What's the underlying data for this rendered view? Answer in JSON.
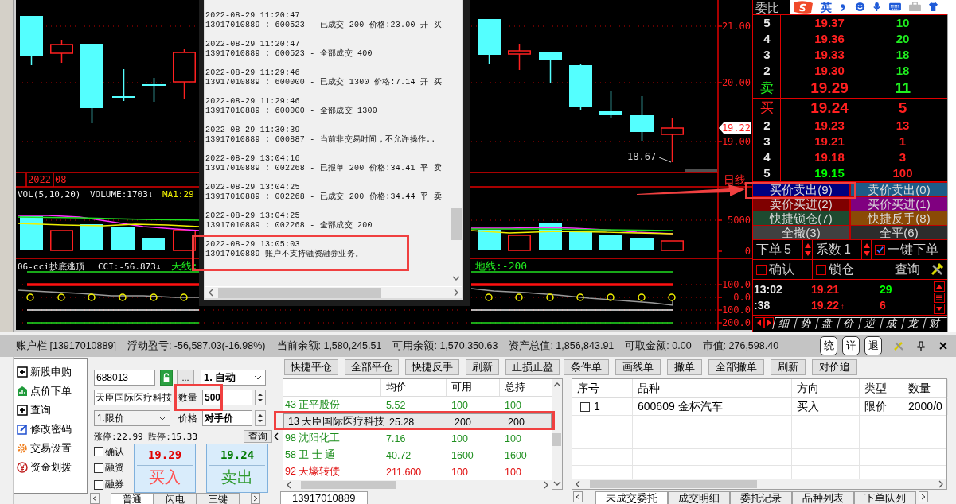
{
  "chart": {
    "price_axis": [
      "21.00",
      "20.00",
      "19.00"
    ],
    "last_price_tag": "19.22",
    "low_label": "18.67",
    "date_labels": [
      "2022",
      "08"
    ],
    "period": "日线",
    "volume_panel": {
      "indicator": "VOL(5,10,20)",
      "reading": "VOLUME:1703↓",
      "ma": "MA1:29"
    },
    "volume_axis": [
      "5000",
      "0"
    ],
    "cci_panel": {
      "indicator": "06-cci抄底逃顶",
      "reading": "CCI:-56.873↓",
      "upper": "天线:",
      "lower": "地线:-200"
    },
    "cci_axis": [
      "100.0",
      "0.0",
      "100.0",
      "200.0"
    ]
  },
  "log_window": {
    "entries": [
      {
        "time": "2022-08-29 11:20:47",
        "message": "13917010889 : 600523 - 已成交 200 价格:23.00 开 买"
      },
      {
        "time": "2022-08-29 11:20:47",
        "message": "13917010889 : 600523 - 全部成交 400"
      },
      {
        "time": "2022-08-29 11:29:46",
        "message": "13917010889 : 600000 - 已成交 1300 价格:7.14 开 买"
      },
      {
        "time": "2022-08-29 11:29:46",
        "message": "13917010889 : 600000 - 全部成交 1300"
      },
      {
        "time": "2022-08-29 11:30:39",
        "message": "13917010889 : 600887 - 当前非交易时间，不允许操作.."
      },
      {
        "time": "2022-08-29 13:04:16",
        "message": "13917010889 : 002268 - 已报单 200 价格:34.41 平 卖"
      },
      {
        "time": "2022-08-29 13:04:25",
        "message": "13917010889 : 002268 - 已成交 200 价格:34.44 平 卖"
      },
      {
        "time": "2022-08-29 13:04:25",
        "message": "13917010889 : 002268 - 全部成交 200"
      },
      {
        "time": "2022-08-29 13:05:03",
        "message": "13917010889 账户不支持融资融券业务。"
      }
    ]
  },
  "ime_toolbar": {
    "mode": "英"
  },
  "order_book": {
    "title": "委比",
    "asks": [
      {
        "level": "5",
        "price": "19.37",
        "volume": "10",
        "color": "#ff2020",
        "kind": "depth"
      },
      {
        "level": "4",
        "price": "19.36",
        "volume": "20",
        "color": "#ff2020",
        "kind": "depth"
      },
      {
        "level": "3",
        "price": "19.33",
        "volume": "18",
        "color": "#ff2020",
        "kind": "depth"
      },
      {
        "level": "2",
        "price": "19.30",
        "volume": "18",
        "color": "#ff2020",
        "kind": "depth"
      },
      {
        "level": "卖",
        "price": "19.29",
        "volume": "11",
        "color": "#ff2020",
        "kind": "best"
      }
    ],
    "bids": [
      {
        "level": "买",
        "price": "19.24",
        "volume": "5",
        "color": "#ff2020",
        "kind": "best"
      },
      {
        "level": "2",
        "price": "19.23",
        "volume": "13",
        "color": "#ff2020",
        "kind": "depth"
      },
      {
        "level": "3",
        "price": "19.21",
        "volume": "1",
        "color": "#ff2020",
        "kind": "depth"
      },
      {
        "level": "4",
        "price": "19.18",
        "volume": "3",
        "color": "#ff2020",
        "kind": "depth"
      },
      {
        "level": "5",
        "price": "19.15",
        "volume": "100",
        "color": "#00ff00",
        "kind": "depth"
      }
    ],
    "actions": [
      {
        "label": "买价卖出(9)",
        "color": "#00007f"
      },
      {
        "label": "卖价卖出(0)",
        "color": "#1d5b88"
      },
      {
        "label": "卖价买进(2)",
        "color": "#7f0000"
      },
      {
        "label": "买价买进(1)",
        "color": "#800080"
      },
      {
        "label": "快捷锁仓(7)",
        "color": "#1e4a30"
      },
      {
        "label": "快捷反手(8)",
        "color": "#8a4a06"
      },
      {
        "label": "全撤(3)",
        "color": "#404040"
      },
      {
        "label": "全平(6)",
        "color": "#2c2c2c"
      }
    ],
    "order_count": {
      "label": "下单",
      "value": "5"
    },
    "multiplier": {
      "label": "系数",
      "value": "1"
    },
    "one_click": {
      "label": "一键下单",
      "checked": true
    },
    "options": [
      {
        "label": "确认",
        "checked": false
      },
      {
        "label": "锁仓",
        "checked": false
      }
    ],
    "query": "查询",
    "ticks": [
      {
        "time": "13:02",
        "price": "19.21",
        "volume": "29",
        "color": "#00ff00"
      },
      {
        "time": ":38",
        "price": "19.22",
        "arrow": "↑",
        "volume": "6",
        "color": "#ff2020"
      }
    ],
    "tabs": [
      {
        "label": "细",
        "selected": false
      },
      {
        "label": "势",
        "selected": false
      },
      {
        "label": "盘",
        "selected": false
      },
      {
        "label": "价",
        "selected": false
      },
      {
        "label": "逆",
        "selected": false
      },
      {
        "label": "成",
        "selected": false
      },
      {
        "label": "龙",
        "selected": false
      },
      {
        "label": "财",
        "selected": false
      }
    ]
  },
  "account_bar": {
    "title": "账户栏 [13917010889]",
    "stats": [
      {
        "label": "浮动盈亏:",
        "value": "-56,587.03(-16.98%)"
      },
      {
        "label": "当前余额:",
        "value": "1,580,245.51"
      },
      {
        "label": "可用余额:",
        "value": "1,570,350.63"
      },
      {
        "label": "资产总值:",
        "value": "1,856,843.91"
      },
      {
        "label": "可取金额:",
        "value": "0.00"
      },
      {
        "label": "市值:",
        "value": "276,598.40"
      }
    ],
    "buttons": [
      "统",
      "详",
      "退"
    ]
  },
  "nav": [
    {
      "label": "新股申购",
      "kind": "group",
      "expanded": false
    },
    {
      "label": "点价下单",
      "kind": "order"
    },
    {
      "label": "查询",
      "kind": "group",
      "expanded": false
    },
    {
      "label": "修改密码",
      "kind": "password"
    },
    {
      "label": "交易设置",
      "kind": "settings"
    },
    {
      "label": "资金划拨",
      "kind": "funds"
    }
  ],
  "order_form": {
    "code": "688013",
    "browse": "...",
    "mode": "1. 自动",
    "name": "天臣国际医疗科技",
    "quantity_label": "数量",
    "quantity": "500",
    "price_type": "1.限价",
    "price_label": "价格",
    "price": "对手价",
    "limits": "涨停:22.99 跌停:15.33",
    "query": "查询",
    "options": [
      {
        "label": "确认",
        "checked": false
      },
      {
        "label": "融资",
        "checked": false
      },
      {
        "label": "融券",
        "checked": false
      }
    ],
    "buy": {
      "price": "19.29",
      "label": "买入"
    },
    "sell": {
      "price": "19.24",
      "label": "卖出"
    },
    "tabs": [
      {
        "label": "普通",
        "selected": true
      },
      {
        "label": "闪电",
        "selected": false
      },
      {
        "label": "三键",
        "selected": false
      }
    ]
  },
  "positions": {
    "toolbar": [
      "快捷平仓",
      "全部平仓",
      "快捷反手",
      "刷新",
      "止损止盈"
    ],
    "columns": [
      "",
      "均价",
      "可用",
      "总持"
    ],
    "rows": [
      {
        "cells": [
          "43 正平股份",
          "5.52",
          "100",
          "100"
        ],
        "color": "#1f8f1f",
        "selected": false
      },
      {
        "cells": [
          "13 天臣国际医疗科技",
          "25.28",
          "200",
          "200"
        ],
        "color": "#000000",
        "selected": true
      },
      {
        "cells": [
          "98 沈阳化工",
          "7.16",
          "100",
          "100"
        ],
        "color": "#1f8f1f",
        "selected": false
      },
      {
        "cells": [
          "58 卫 士 通",
          "40.72",
          "1600",
          "1600"
        ],
        "color": "#1f8f1f",
        "selected": false
      },
      {
        "cells": [
          "92 天壕转债",
          "211.600",
          "100",
          "100"
        ],
        "color": "#e01010",
        "selected": false
      }
    ],
    "tabs": [
      {
        "label": "13917010889",
        "selected": true
      }
    ]
  },
  "orders": {
    "toolbar": [
      "条件单",
      "画线单",
      "撤单",
      "全部撤单",
      "刷新",
      "对价追"
    ],
    "columns": [
      "序号",
      "品种",
      "方向",
      "类型",
      "数量"
    ],
    "rows": [
      {
        "checked": false,
        "cells": [
          "1",
          "600609 金杯汽车",
          "买入",
          "限价",
          "2000/0"
        ]
      }
    ],
    "tabs": [
      {
        "label": "未成交委托",
        "selected": true
      },
      {
        "label": "成交明细",
        "selected": false
      },
      {
        "label": "委托记录",
        "selected": false
      },
      {
        "label": "品种列表",
        "selected": false
      },
      {
        "label": "下单队列",
        "selected": false
      }
    ]
  }
}
